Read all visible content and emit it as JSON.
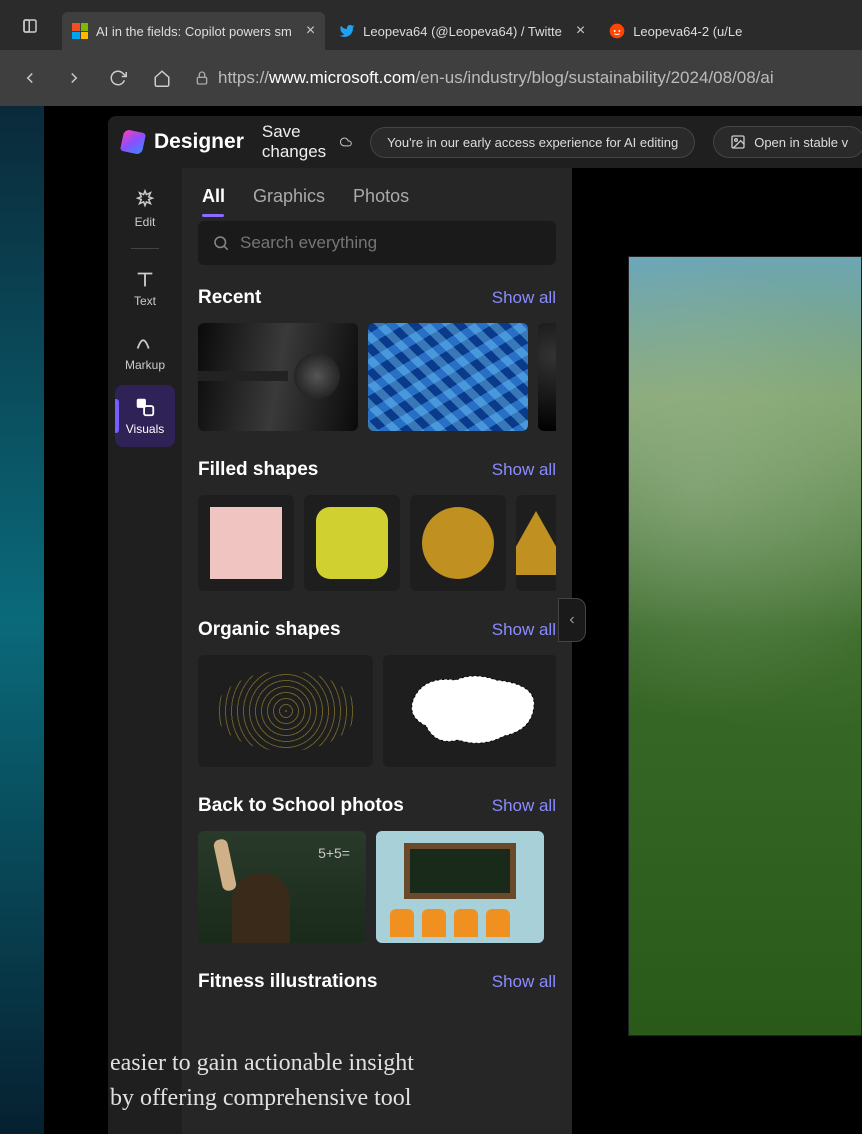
{
  "browser": {
    "tabs": [
      {
        "title": "AI in the fields: Copilot powers sm",
        "favicon": "ms-logo",
        "active": true
      },
      {
        "title": "Leopeva64 (@Leopeva64) / Twitte",
        "favicon": "twitter",
        "active": false
      },
      {
        "title": "Leopeva64-2 (u/Le",
        "favicon": "reddit",
        "active": false
      }
    ],
    "url_prefix": "https://",
    "url_host": "www.microsoft.com",
    "url_path": "/en-us/industry/blog/sustainability/2024/08/08/ai"
  },
  "designer": {
    "app_name": "Designer",
    "save_label": "Save changes",
    "banner": "You're in our early access experience for AI editing",
    "open_stable": "Open in stable v",
    "rail": [
      {
        "id": "edit",
        "label": "Edit"
      },
      {
        "id": "text",
        "label": "Text"
      },
      {
        "id": "markup",
        "label": "Markup"
      },
      {
        "id": "visuals",
        "label": "Visuals"
      }
    ],
    "active_rail": "visuals"
  },
  "visuals": {
    "tabs": [
      "All",
      "Graphics",
      "Photos"
    ],
    "active_tab": "All",
    "search_placeholder": "Search everything",
    "show_all_label": "Show all",
    "sections": {
      "recent": "Recent",
      "filled": "Filled shapes",
      "organic": "Organic shapes",
      "school": "Back to School photos",
      "fitness": "Fitness illustrations"
    }
  },
  "article": {
    "line1": "easier to gain actionable insight",
    "line2": "by offering comprehensive tool"
  }
}
